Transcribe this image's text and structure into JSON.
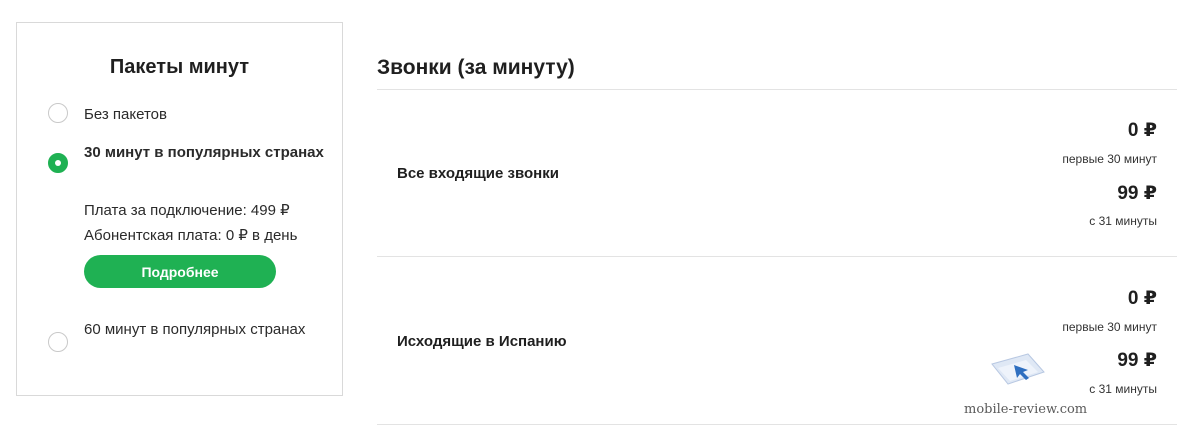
{
  "packages": {
    "title": "Пакеты минут",
    "options": [
      {
        "label": "Без пакетов",
        "checked": false
      },
      {
        "label": "30 минут в популярных странах",
        "checked": true,
        "connection_fee": "Плата за подключение: 499 ₽",
        "subscription_fee": "Абонентская плата: 0 ₽ в день",
        "button": "Подробнее"
      },
      {
        "label": "60 минут в популярных странах",
        "checked": false
      }
    ],
    "accent_color": "#1fb153"
  },
  "calls": {
    "title": "Звонки (за минуту)",
    "rows": [
      {
        "label": "Все входящие звонки",
        "prices": [
          {
            "amount": "0 ₽",
            "note": "первые 30 минут"
          },
          {
            "amount": "99 ₽",
            "note": "с 31 минуты"
          }
        ]
      },
      {
        "label": "Исходящие в Испанию",
        "prices": [
          {
            "amount": "0 ₽",
            "note": "первые 30 минут"
          },
          {
            "amount": "99 ₽",
            "note": "с 31 минуты"
          }
        ]
      }
    ]
  },
  "watermark": {
    "text": "mobile-review.com",
    "logo_icon": "mobile-review-logo-icon"
  }
}
